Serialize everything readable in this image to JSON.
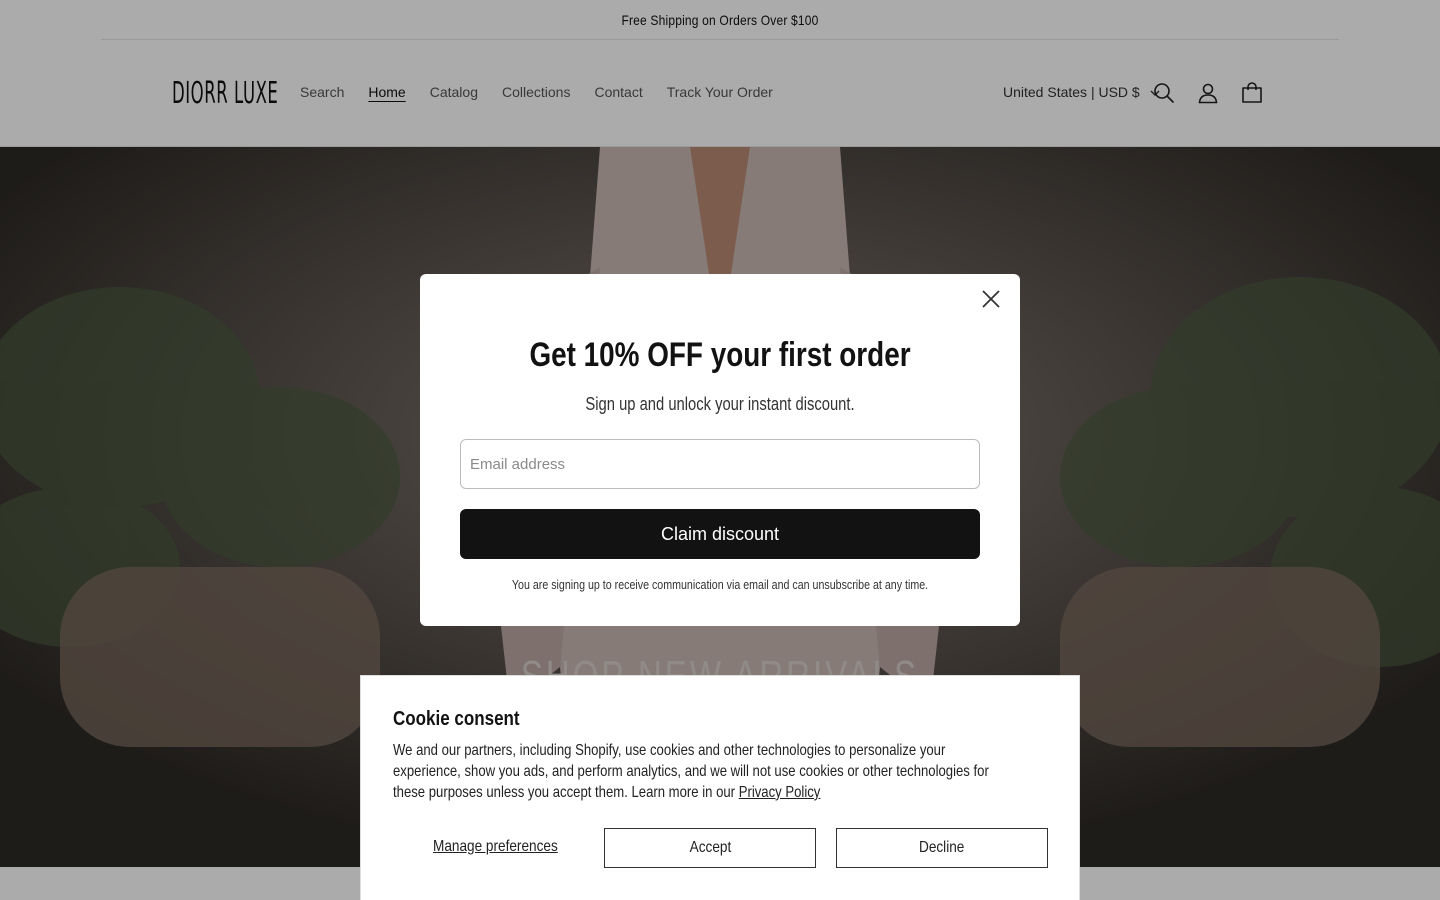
{
  "announcement": {
    "text": "Free Shipping on Orders Over $100"
  },
  "header": {
    "logo": "DIORR LUXE",
    "nav": [
      {
        "label": "Search"
      },
      {
        "label": "Home",
        "active": true
      },
      {
        "label": "Catalog"
      },
      {
        "label": "Collections"
      },
      {
        "label": "Contact"
      },
      {
        "label": "Track Your Order"
      }
    ],
    "locale": "United States | USD $",
    "icons": [
      "search-icon",
      "account-icon",
      "cart-icon",
      "chevron-down-icon"
    ]
  },
  "hero": {
    "title": "SHOP NEW ARRIVALS"
  },
  "modal": {
    "title": "Get 10% OFF your first order",
    "subtitle": "Sign up and unlock your instant discount.",
    "email_placeholder": "Email address",
    "email_value": "",
    "button": "Claim discount",
    "fine_print": "You are signing up to receive communication via email and can unsubscribe at any time."
  },
  "cookie": {
    "title": "Cookie consent",
    "body": "We and our partners, including Shopify, use cookies and other technologies to personalize your experience, show you ads, and perform analytics, and we will not use cookies or other technologies for these purposes unless you accept them. Learn more in our",
    "link": "Privacy Policy",
    "manage": "Manage preferences",
    "accept": "Accept",
    "decline": "Decline"
  },
  "colors": {
    "text": "#121212",
    "button_dark": "#121212",
    "overlay": "rgba(0,0,0,0.33)"
  }
}
